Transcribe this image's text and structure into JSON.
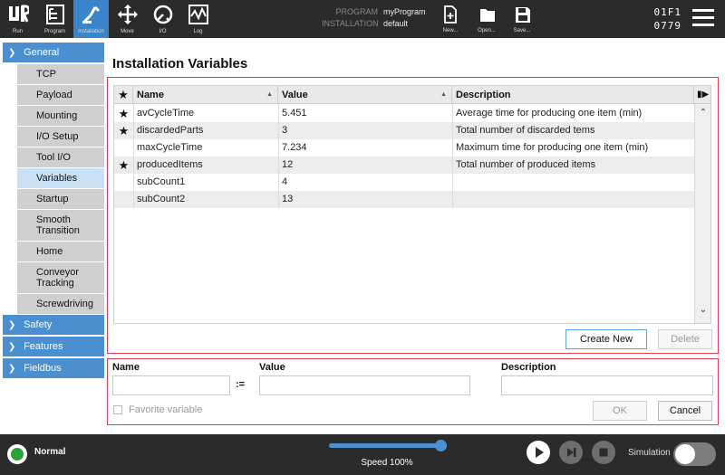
{
  "topbar": {
    "nav": [
      {
        "label": "Run",
        "icon": "ur-logo-icon"
      },
      {
        "label": "Program",
        "icon": "program-icon"
      },
      {
        "label": "Installation",
        "icon": "installation-icon"
      },
      {
        "label": "Move",
        "icon": "move-icon"
      },
      {
        "label": "I/O",
        "icon": "io-icon"
      },
      {
        "label": "Log",
        "icon": "log-icon"
      }
    ],
    "program_key": "PROGRAM",
    "program_value": "myProgram",
    "installation_key": "INSTALLATION",
    "installation_value": "default",
    "file_buttons": [
      {
        "label": "New...",
        "icon": "new-file-icon"
      },
      {
        "label": "Open...",
        "icon": "folder-icon"
      },
      {
        "label": "Save...",
        "icon": "save-icon"
      }
    ],
    "robot_id_line1": "01F1",
    "robot_id_line2": "0779"
  },
  "sidebar": {
    "groups": [
      {
        "label": "General",
        "expanded": true
      },
      {
        "label": "Safety",
        "expanded": false
      },
      {
        "label": "Features",
        "expanded": false
      },
      {
        "label": "Fieldbus",
        "expanded": false
      }
    ],
    "general_items": [
      {
        "label": "TCP"
      },
      {
        "label": "Payload"
      },
      {
        "label": "Mounting"
      },
      {
        "label": "I/O Setup"
      },
      {
        "label": "Tool I/O"
      },
      {
        "label": "Variables",
        "selected": true
      },
      {
        "label": "Startup"
      },
      {
        "label": "Smooth\nTransition"
      },
      {
        "label": "Home"
      },
      {
        "label": "Conveyor\nTracking"
      },
      {
        "label": "Screwdriving"
      }
    ]
  },
  "main": {
    "title": "Installation Variables",
    "table": {
      "headers": {
        "star": "★",
        "name": "Name",
        "value": "Value",
        "description": "Description"
      },
      "rows": [
        {
          "star": "★",
          "name": "avCycleTime",
          "value": "5.451",
          "description": "Average time for producing one item (min)"
        },
        {
          "star": "★",
          "name": "discardedParts",
          "value": "3",
          "description": "Total number of discarded tems"
        },
        {
          "star": "",
          "name": "maxCycleTime",
          "value": "7.234",
          "description": "Maximum time for producing one item (min)"
        },
        {
          "star": "★",
          "name": "producedItems",
          "value": "12",
          "description": "Total number of produced items"
        },
        {
          "star": "",
          "name": "subCount1",
          "value": "4",
          "description": ""
        },
        {
          "star": "",
          "name": "subCount2",
          "value": "13",
          "description": ""
        }
      ]
    },
    "buttons": {
      "create_new": "Create New",
      "delete": "Delete"
    },
    "form": {
      "name_label": "Name",
      "assign_op": ":=",
      "value_label": "Value",
      "description_label": "Description",
      "name_value": "",
      "value_value": "",
      "description_value": "",
      "favorite_label": "Favorite variable",
      "ok": "OK",
      "cancel": "Cancel"
    }
  },
  "bottombar": {
    "status": "Normal",
    "status_color": "#29a339",
    "speed_text": "Speed 100%",
    "speed_fraction": 1.0,
    "simulation_label": "Simulation",
    "simulation_on": false
  },
  "colors": {
    "accent": "#4a90d0",
    "panel_border": "#e0404f"
  }
}
